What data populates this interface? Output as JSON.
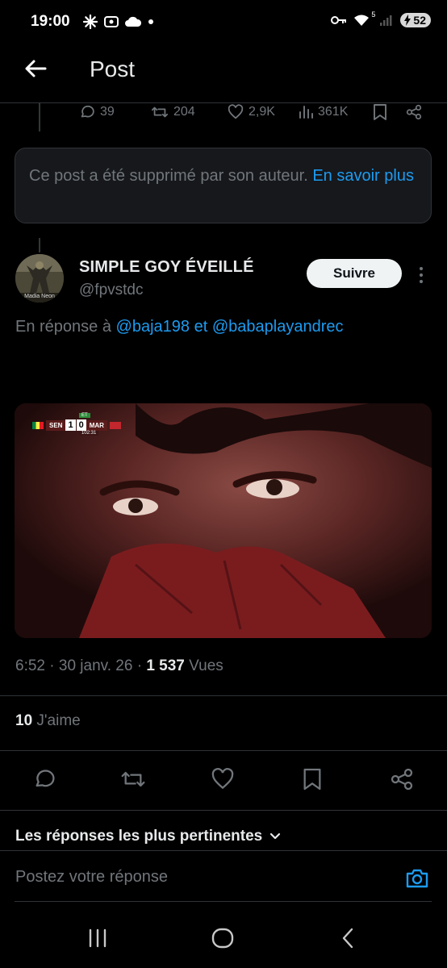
{
  "status_bar": {
    "time": "19:00",
    "wifi_badge": "5",
    "battery": "52"
  },
  "header": {
    "title": "Post"
  },
  "parent_actions": {
    "replies": "39",
    "reposts": "204",
    "likes": "2,9K",
    "views": "361K"
  },
  "deleted_notice": {
    "text": "Ce post a été supprimé par son auteur.",
    "link": "En savoir plus"
  },
  "post": {
    "author_name": "SIMPLE GOY ÉVEILLÉ",
    "author_handle": "@fpvstdc",
    "follow_label": "Suivre",
    "reply_prefix": "En réponse à",
    "reply_user1": "@baja198",
    "reply_conj": "et",
    "reply_user2": "@babaplayandrec",
    "avatar_caption": "Madia Neon",
    "media": {
      "team_home": "SEN",
      "score_home": "1",
      "score_away": "0",
      "team_away": "MAR",
      "period": "ET",
      "clock": "102:31"
    },
    "time": "6:52",
    "date": "30 janv. 26",
    "views_count": "1 537",
    "views_label": "Vues",
    "likes_count": "10",
    "likes_label": "J'aime"
  },
  "replies_section": {
    "sort_label": "Les réponses les plus pertinentes",
    "composer_placeholder": "Postez votre réponse"
  },
  "colors": {
    "background": "#000000",
    "accent": "#1d9bf0",
    "muted_text": "#71767b",
    "divider": "#2f3336"
  }
}
